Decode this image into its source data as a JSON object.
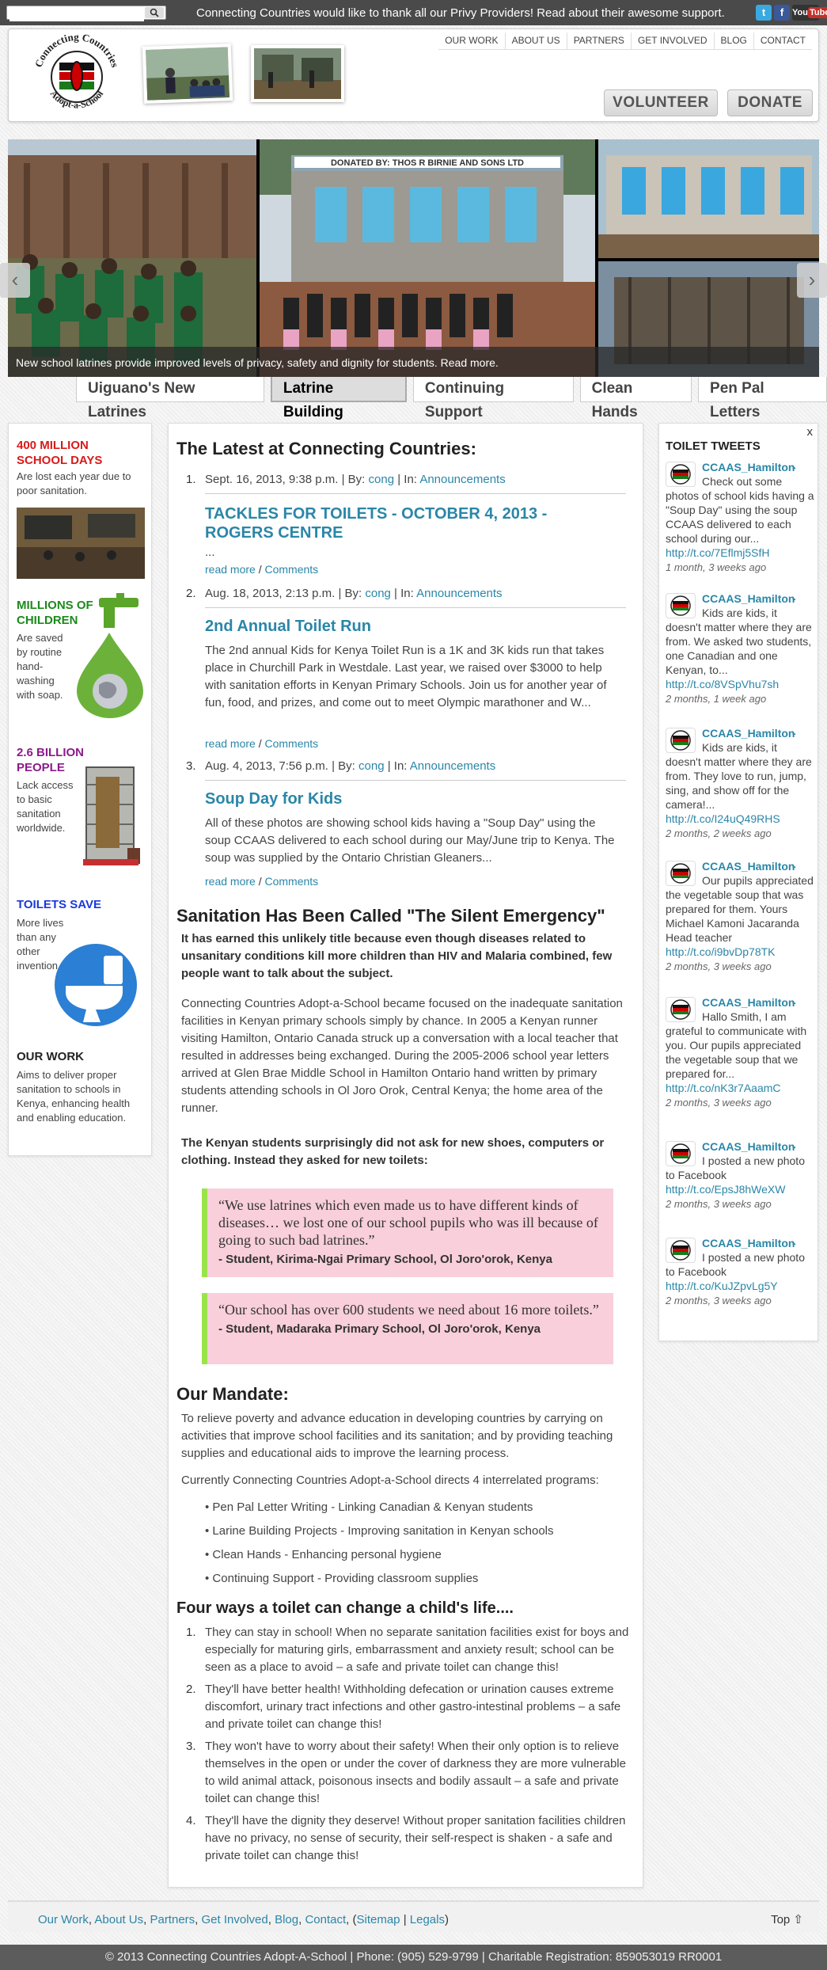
{
  "topbar": {
    "search_placeholder": "",
    "message": "Connecting Countries would like to thank all our Privy Providers! Read about their awesome support.",
    "social": {
      "twitter": "t",
      "facebook": "f",
      "youtube": "You",
      "youtube_b": "Tube"
    }
  },
  "header": {
    "logo_top": "Connecting Countries",
    "logo_bottom": "Adopt-a-School",
    "nav": [
      "OUR WORK",
      "ABOUT US",
      "PARTNERS",
      "GET INVOLVED",
      "BLOG",
      "CONTACT"
    ],
    "volunteer": "VOLUNTEER",
    "donate": "DONATE",
    "slider_caption": "New school latrines provide improved levels of privacy, safety and dignity for students. Read more.",
    "donated_sign": "DONATED BY: THOS R BIRNIE AND SONS LTD",
    "tabs": [
      "Uiguano's New Latrines",
      "Latrine Building",
      "Continuing Support",
      "Clean Hands",
      "Pen Pal Letters"
    ],
    "active_tab": "Latrine Building"
  },
  "left": {
    "f1_title": "400 MILLION SCHOOL DAYS",
    "f1_text": "Are lost each year due to poor sanitation.",
    "f2_title": "MILLIONS OF CHILDREN",
    "f2_text": "Are saved by routine hand-washing with soap.",
    "f3_title": "2.6 BILLION PEOPLE",
    "f3_text": "Lack access to basic sanitation worldwide.",
    "f4_title": "TOILETS SAVE",
    "f4_text": "More lives than any other invention.",
    "f5_title": "OUR WORK",
    "f5_text": "Aims to deliver proper sanitation to schools in Kenya, enhancing health and enabling education.",
    "colors": {
      "red": "#d91a1a",
      "green": "#1b8a1b",
      "purple": "#8b1a8b",
      "blue": "#1a3ad9"
    }
  },
  "main": {
    "latest_heading": "The Latest at Connecting Countries:",
    "posts": [
      {
        "num": "1.",
        "meta_pre": "Sept. 16, 2013, 9:38 p.m. | By: ",
        "author": "cong",
        "meta_mid": " | In: ",
        "category": "Announcements",
        "title": "TACKLES FOR TOILETS - OCTOBER 4, 2013 - ROGERS CENTRE",
        "excerpt": "...",
        "read_more": "read more",
        "comments": "Comments"
      },
      {
        "num": "2.",
        "meta_pre": "Aug. 18, 2013, 2:13 p.m. | By: ",
        "author": "cong",
        "meta_mid": " | In: ",
        "category": "Announcements",
        "title": "2nd Annual Toilet Run",
        "excerpt": "The 2nd annual Kids for Kenya Toilet Run is a 1K and 3K kids run that takes place in Churchill Park in Westdale. Last year, we raised over $3000 to help with sanitation efforts in Kenyan Primary Schools. Join us for another year of fun, food, and prizes, and come out to meet Olympic marathoner and W...",
        "read_more": "read more",
        "comments": "Comments"
      },
      {
        "num": "3.",
        "meta_pre": "Aug. 4, 2013, 7:56 p.m. | By: ",
        "author": "cong",
        "meta_mid": " | In: ",
        "category": "Announcements",
        "title": "Soup Day for Kids",
        "excerpt": "All of these photos are showing school kids having a \"Soup Day\" using the soup CCAAS delivered to each school during our May/June trip to Kenya. The soup was supplied by the Ontario Christian Gleaners...",
        "read_more": "read more",
        "comments": "Comments"
      }
    ],
    "silent_heading": "Sanitation Has Been Called \"The Silent Emergency\"",
    "silent_bold": "It has earned this unlikely title because even though diseases related to unsanitary conditions kill more children than HIV and Malaria combined, few people want to talk about the subject.",
    "silent_body": "Connecting Countries Adopt-a-School became focused on the inadequate sanitation facilities in Kenyan primary schools simply by chance. In 2005 a Kenyan runner visiting Hamilton, Ontario Canada struck up a conversation with a local teacher that resulted in addresses being exchanged. During the 2005-2006 school year letters arrived at Glen Brae Middle School in Hamilton Ontario hand written by primary students attending schools in Ol Joro Orok, Central Kenya; the home area of the runner.",
    "students_bold": "The Kenyan students surprisingly did not ask for new shoes, computers or clothing. Instead they asked for new toilets:",
    "quotes": [
      {
        "text": "“We use latrines which even made us to have different kinds of diseases… we lost one of our school pupils who was ill because of going to such bad latrines.”",
        "source": "- Student, Kirima-Ngai Primary School, Ol Joro'orok, Kenya"
      },
      {
        "text": "“Our school has over 600 students we need about 16 more toilets.”",
        "source": "- Student, Madaraka Primary School, Ol Joro'orok, Kenya"
      }
    ],
    "mandate_heading": "Our Mandate:",
    "mandate_body": "To relieve poverty and advance education in developing countries by carrying on activities that improve school facilities and its sanitation; and by providing teaching supplies and educational aids to improve the learning process.",
    "programs_intro": "Currently Connecting Countries Adopt-a-School directs 4 interrelated programs:",
    "programs": [
      "Pen Pal Letter Writing - Linking Canadian & Kenyan students",
      "Larine Building Projects - Improving sanitation in Kenyan schools",
      "Clean Hands - Enhancing personal hygiene",
      "Continuing Support - Providing classroom supplies"
    ],
    "four_heading": "Four ways a toilet can change a child's life....",
    "four": [
      {
        "num": "1.",
        "text": "They can stay in school! When no separate sanitation facilities exist for boys and especially for maturing girls, embarrassment and anxiety result; school can be seen as a place to avoid – a safe and private toilet can change this!"
      },
      {
        "num": "2.",
        "text": "They'll have better health! Withholding defecation or urination causes extreme discomfort, urinary tract infections and other gastro-intestinal problems – a safe and private toilet can change this!"
      },
      {
        "num": "3.",
        "text": "They won't have to worry about their safety! When their only option is to relieve themselves in the open or under the cover of darkness they are more vulnerable to wild animal attack, poisonous insects and bodily assault – a safe and private toilet can change this!"
      },
      {
        "num": "4.",
        "text": "They'll have the dignity they deserve! Without proper sanitation facilities children have no privacy, no sense of security, their self-respect is shaken - a safe and private toilet can change this!"
      }
    ]
  },
  "right": {
    "close": "x",
    "heading": "TOILET TWEETS",
    "tweets": [
      {
        "user": "CCAAS_Hamilton",
        "text": "Check out some photos of school kids having a \"Soup Day\" using the soup CCAAS delivered to each school during our...",
        "link": "http://t.co/7Eflmj5SfH",
        "time": "1 month, 3 weeks ago"
      },
      {
        "user": "CCAAS_Hamilton",
        "text": "Kids are kids, it doesn't matter where they are from. We asked two students, one Canadian and one Kenyan, to...",
        "link": "http://t.co/8VSpVhu7sh",
        "time": "2 months, 1 week ago"
      },
      {
        "user": "CCAAS_Hamilton",
        "text": "Kids are kids, it doesn't matter where they are from. They love to run, jump, sing, and show off for the camera!...",
        "link": "http://t.co/I24uQ49RHS",
        "time": "2 months, 2 weeks ago"
      },
      {
        "user": "CCAAS_Hamilton",
        "text": "Our pupils appreciated the vegetable soup that was prepared for them. Yours Michael Kamoni Jacaranda Head teacher",
        "link": "http://t.co/i9bvDp78TK",
        "time": "2 months, 3 weeks ago"
      },
      {
        "user": "CCAAS_Hamilton",
        "text": "Hallo Smith, I am grateful to communicate with you. Our pupils appreciated the vegetable soup that we prepared for...",
        "link": "http://t.co/nK3r7AaamC",
        "time": "2 months, 3 weeks ago"
      },
      {
        "user": "CCAAS_Hamilton",
        "text": "I posted a new photo to Facebook",
        "link": "http://t.co/EpsJ8hWeXW",
        "time": "2 months, 3 weeks ago"
      },
      {
        "user": "CCAAS_Hamilton",
        "text": "I posted a new photo to Facebook",
        "link": "http://t.co/KuJZpvLg5Y",
        "time": "2 months, 3 weeks ago"
      }
    ]
  },
  "footer": {
    "links": [
      "Our Work",
      "About Us",
      "Partners",
      "Get Involved",
      "Blog",
      "Contact"
    ],
    "sitemap": "Sitemap",
    "legals": "Legals",
    "top": "Top ⇧",
    "copyright": "© 2013 Connecting Countries Adopt-A-School | Phone: (905) 529-9799 | Charitable Registration: 859053019 RR0001"
  }
}
